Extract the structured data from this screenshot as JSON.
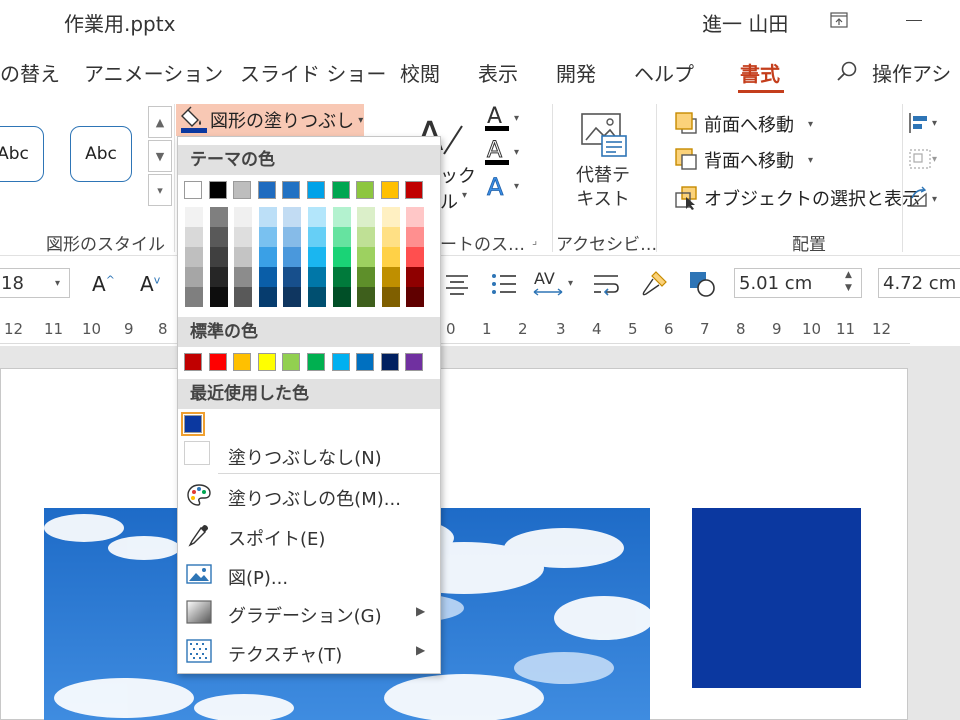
{
  "window": {
    "title": "作業用.pptx",
    "user": "進一 山田"
  },
  "tabs": [
    {
      "label": "の替え"
    },
    {
      "label": "アニメーション"
    },
    {
      "label": "スライド ショー"
    },
    {
      "label": "校閲"
    },
    {
      "label": "表示"
    },
    {
      "label": "開発"
    },
    {
      "label": "ヘルプ"
    },
    {
      "label": "書式",
      "active": true
    }
  ],
  "search": {
    "label": "操作アシ"
  },
  "ribbon": {
    "shape_style_sample": "Abc",
    "shape_styles_group": "図形のスタイル",
    "fill_button": "図形の塗りつぶし",
    "wordart_partial_1": "ック",
    "wordart_partial_2": "ル",
    "wordart_group": "ートのス…",
    "accessibility_group": "アクセシビ…",
    "alt_text": "代替テ\nキスト",
    "bring_forward": "前面へ移動",
    "send_backward": "背面へ移動",
    "selection_pane": "オブジェクトの選択と表示",
    "arrange_group": "配置"
  },
  "formatbar": {
    "font_size": "18",
    "height_value": "5.01 cm",
    "width_value": "4.72 cm"
  },
  "ruler": {
    "left": [
      "12",
      "11",
      "10",
      "9",
      "8"
    ],
    "right": [
      "0",
      "1",
      "2",
      "3",
      "4",
      "5",
      "6",
      "7",
      "8",
      "9",
      "10",
      "11",
      "12"
    ]
  },
  "fill_menu": {
    "theme_colors_header": "テーマの色",
    "standard_colors_header": "標準の色",
    "recent_colors_header": "最近使用した色",
    "theme_base": [
      "#ffffff",
      "#000000",
      "#bdbdbd",
      "#1f6bbf",
      "#2272c3",
      "#00a2e8",
      "#00a651",
      "#8dc63f",
      "#ffc000",
      "#c00000"
    ],
    "theme_tints": [
      [
        "#f2f2f2",
        "#7f7f7f",
        "#f0f0f0",
        "#bcdff7",
        "#c2dcf3",
        "#b3e6fb",
        "#b3f2cf",
        "#dbefc9",
        "#fff0c2",
        "#ffc7c7"
      ],
      [
        "#d9d9d9",
        "#595959",
        "#dedede",
        "#79c1f0",
        "#86bbe8",
        "#66cff6",
        "#66e3a0",
        "#bfe095",
        "#ffe085",
        "#ff8f8f"
      ],
      [
        "#bfbfbf",
        "#404040",
        "#c4c4c4",
        "#3aa0e6",
        "#4a98dc",
        "#1ab6f0",
        "#1ad376",
        "#9dd160",
        "#ffd147",
        "#ff4f4f"
      ],
      [
        "#a6a6a6",
        "#262626",
        "#8c8c8c",
        "#0a5ea8",
        "#174f8c",
        "#0077a8",
        "#007a3b",
        "#5e8f2a",
        "#bf8f00",
        "#8f0000"
      ],
      [
        "#7f7f7f",
        "#0d0d0d",
        "#595959",
        "#063c6e",
        "#0f3660",
        "#004f70",
        "#004f27",
        "#3e5f1c",
        "#7f5f00",
        "#600000"
      ]
    ],
    "standard": [
      "#c00000",
      "#ff0000",
      "#ffc000",
      "#ffff00",
      "#92d050",
      "#00b050",
      "#00b0f0",
      "#0070c0",
      "#002060",
      "#7030a0"
    ],
    "recent": [
      "#0b38a0"
    ],
    "no_fill": "塗りつぶしなし(N)",
    "more_colors": "塗りつぶしの色(M)...",
    "eyedropper": "スポイト(E)",
    "picture": "図(P)...",
    "gradient": "グラデーション(G)",
    "texture": "テクスチャ(T)"
  },
  "colors": {
    "accent": "#c43e1c",
    "fill_button_bg": "#f8c8b4",
    "shape_fill": "#0b38a0"
  }
}
